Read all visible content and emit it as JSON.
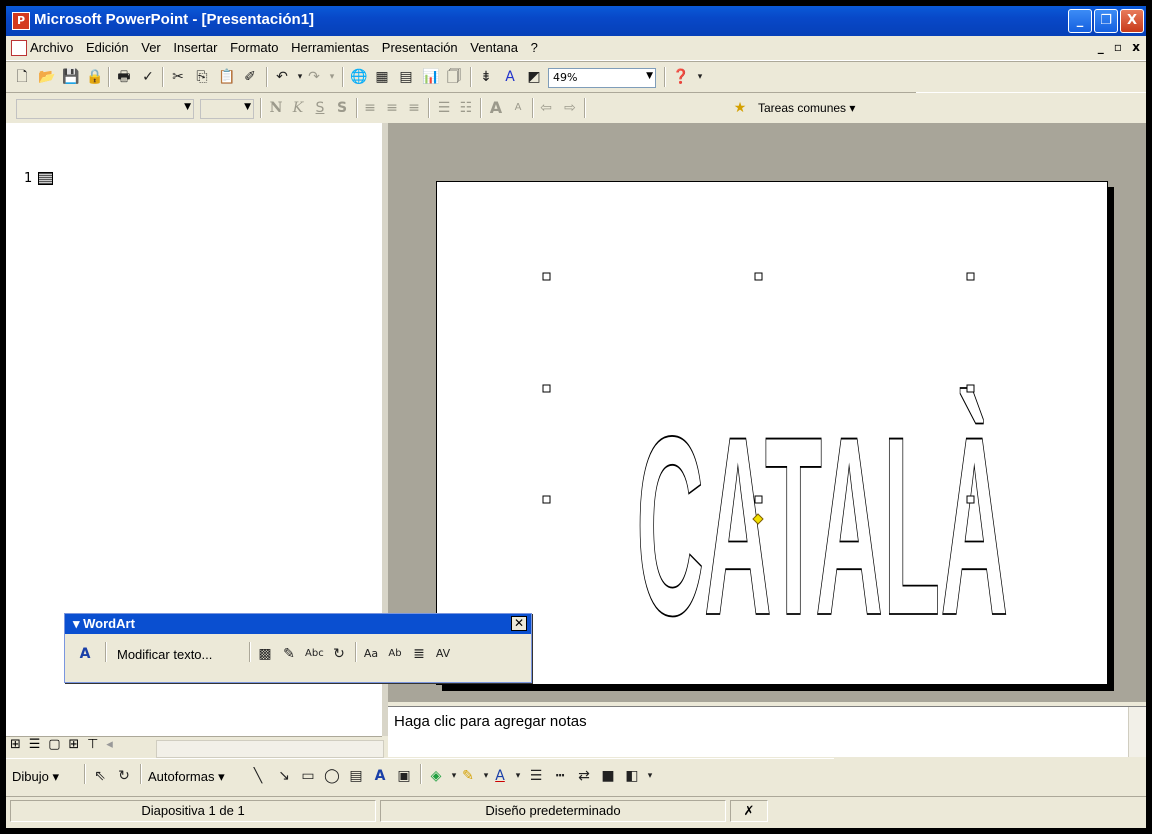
{
  "window": {
    "title": "Microsoft PowerPoint - [Presentación1]",
    "app_icon": "P",
    "controls": {
      "minimize": "_",
      "restore": "❐",
      "close": "X"
    }
  },
  "menubar": {
    "items": [
      "Archivo",
      "Edición",
      "Ver",
      "Insertar",
      "Formato",
      "Herramientas",
      "Presentación",
      "Ventana",
      "?"
    ],
    "doc_controls": [
      "_",
      "▫",
      "x"
    ]
  },
  "standard_toolbar": {
    "zoom": "49%",
    "icons": [
      "new-icon",
      "open-icon",
      "save-icon",
      "permission-icon",
      "print-icon",
      "spelling-icon",
      "cut-icon",
      "copy-icon",
      "paste-icon",
      "format-painter-icon",
      "undo-icon",
      "redo-icon",
      "hyperlink-icon",
      "tables-borders-icon",
      "insert-table-icon",
      "insert-chart-icon",
      "new-slide-icon",
      "expand-all-icon",
      "show-formatting-icon",
      "grayscale-icon",
      "help-icon"
    ]
  },
  "formatting_toolbar": {
    "font": "",
    "size": "",
    "tareas_label": "Tareas comunes",
    "bold": "N",
    "italic": "K",
    "underline": "S",
    "shadow": "S"
  },
  "outline": {
    "slide_number": "1"
  },
  "slide": {
    "wordart_text": "CATALÀ"
  },
  "notes": {
    "placeholder": "Haga clic para agregar notas"
  },
  "wordart_toolbar": {
    "title": "WordArt",
    "edit_text": "Modificar texto...",
    "close": "✕"
  },
  "drawing_toolbar": {
    "draw_label": "Dibujo",
    "autoshapes_label": "Autoformas"
  },
  "statusbar": {
    "slide": "Diapositiva 1 de 1",
    "design": "Diseño predeterminado"
  },
  "colors": {
    "titlebar": "#0A5AD8",
    "chrome": "#ECE9D8",
    "slide_bg": "#A8A599",
    "wordart_handle": "#F2E000"
  }
}
